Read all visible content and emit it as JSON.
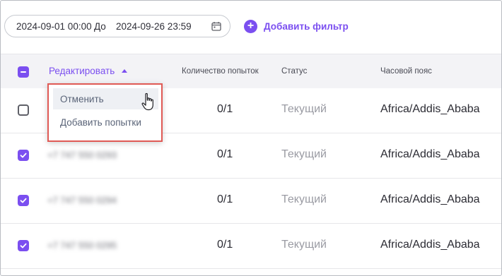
{
  "filter": {
    "from": "2024-09-01 00:00",
    "separator": "До",
    "to": "2024-09-26 23:59",
    "add_filter_label": "Добавить фильтр"
  },
  "table": {
    "headers": {
      "edit": "Редактировать",
      "attempts": "Количество попыток",
      "status": "Статус",
      "timezone": "Часовой пояс"
    },
    "rows": [
      {
        "checked": false,
        "attempts": "0/1",
        "status": "Текущий",
        "timezone": "Africa/Addis_Ababa"
      },
      {
        "checked": true,
        "phone": "+7 747 550 0293",
        "attempts": "0/1",
        "status": "Текущий",
        "timezone": "Africa/Addis_Ababa"
      },
      {
        "checked": true,
        "phone": "+7 747 550 0294",
        "attempts": "0/1",
        "status": "Текущий",
        "timezone": "Africa/Addis_Ababa"
      },
      {
        "checked": true,
        "phone": "+7 747 550 0295",
        "attempts": "0/1",
        "status": "Текущий",
        "timezone": "Africa/Addis_Ababa"
      }
    ]
  },
  "dropdown": {
    "items": [
      "Отменить",
      "Добавить попытки"
    ]
  },
  "colors": {
    "accent": "#7b4ff0",
    "highlight_border": "#e05a55",
    "status_text": "#9a9ba3"
  }
}
